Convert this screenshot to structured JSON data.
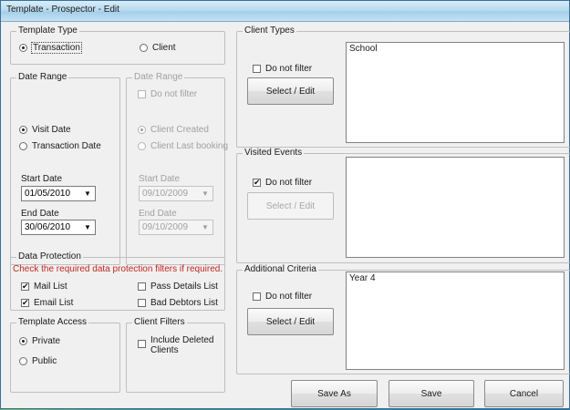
{
  "window": {
    "title": "Template - Prospector - Edit"
  },
  "template_type": {
    "legend": "Template Type",
    "transaction": {
      "label": "Transaction",
      "selected": true
    },
    "client": {
      "label": "Client",
      "selected": false
    }
  },
  "date_range": {
    "legend": "Date Range",
    "visit_date": {
      "label": "Visit Date",
      "selected": true
    },
    "transaction_date": {
      "label": "Transaction Date",
      "selected": false
    },
    "start_label": "Start Date",
    "start_value": "01/05/2010",
    "end_label": "End Date",
    "end_value": "30/06/2010"
  },
  "date_range_client": {
    "legend": "Date Range",
    "do_not_filter": {
      "label": "Do not filter",
      "checked": false
    },
    "client_created": {
      "label": "Client Created",
      "selected": true
    },
    "client_last_booking": {
      "label": "Client Last booking",
      "selected": false
    },
    "start_label": "Start Date",
    "start_value": "09/10/2009",
    "end_label": "End Date",
    "end_value": "09/10/2009"
  },
  "data_protection": {
    "legend": "Data Protection",
    "note": "Check the required data protection filters if required.",
    "mail_list": {
      "label": "Mail List",
      "checked": true
    },
    "pass_details_list": {
      "label": "Pass Details List",
      "checked": false
    },
    "email_list": {
      "label": "Email List",
      "checked": true
    },
    "bad_debtors_list": {
      "label": "Bad Debtors List",
      "checked": false
    }
  },
  "template_access": {
    "legend": "Template Access",
    "private": {
      "label": "Private",
      "selected": true
    },
    "public": {
      "label": "Public",
      "selected": false
    }
  },
  "client_filters": {
    "legend": "Client Filters",
    "include_deleted": {
      "label_line1": "Include Deleted",
      "label_line2": "Clients",
      "checked": false
    }
  },
  "client_types": {
    "legend": "Client Types",
    "do_not_filter": {
      "label": "Do not filter",
      "checked": false
    },
    "select_button": "Select / Edit",
    "items": [
      "School"
    ]
  },
  "visited_events": {
    "legend": "Visited Events",
    "do_not_filter": {
      "label": "Do not filter",
      "checked": true
    },
    "select_button": "Select / Edit",
    "items": []
  },
  "additional_criteria": {
    "legend": "Additional Criteria",
    "do_not_filter": {
      "label": "Do not filter",
      "checked": false
    },
    "select_button": "Select / Edit",
    "items": [
      "Year 4"
    ]
  },
  "footer": {
    "save_as": "Save As",
    "save": "Save",
    "cancel": "Cancel"
  },
  "glyphs": {
    "check": "✔",
    "dropdown": "▼"
  }
}
